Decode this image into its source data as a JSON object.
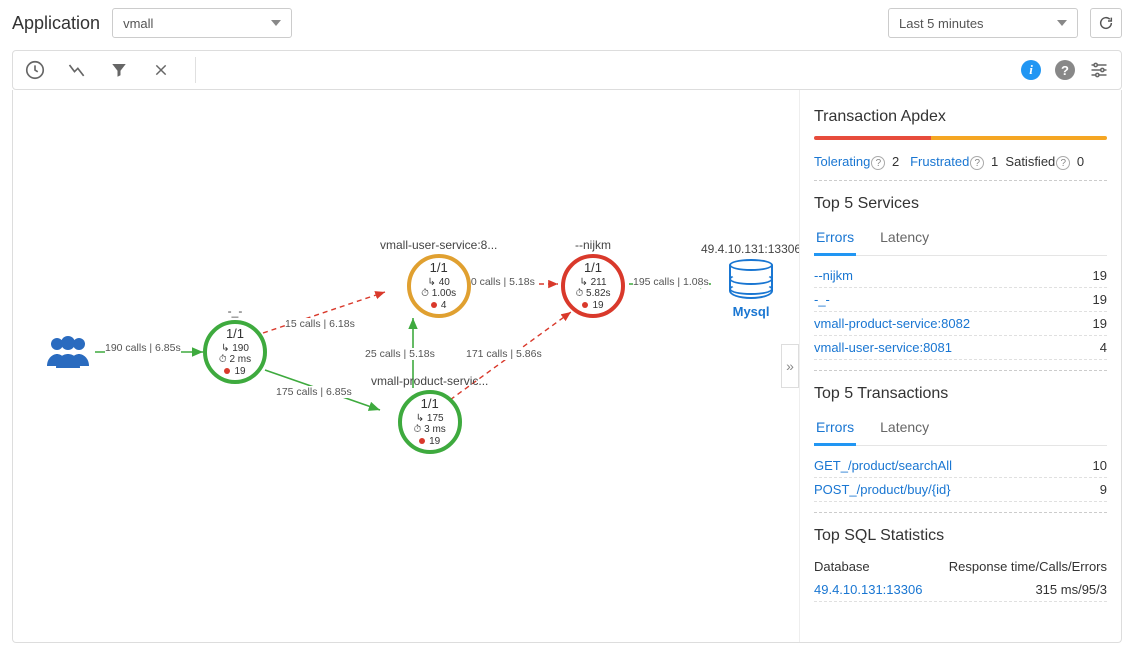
{
  "header": {
    "app_label": "Application",
    "app_value": "vmall",
    "time_value": "Last 5 minutes"
  },
  "apdex": {
    "title": "Transaction Apdex",
    "segments": [
      {
        "color": "#e74c3c",
        "pct": 40
      },
      {
        "color": "#f5a623",
        "pct": 60
      }
    ],
    "tolerating_label": "Tolerating",
    "tolerating_val": "2",
    "frustrated_label": "Frustrated",
    "frustrated_val": "1",
    "satisfied_label": "Satisfied",
    "satisfied_val": "0"
  },
  "top_services": {
    "title": "Top 5 Services",
    "tabs": {
      "errors": "Errors",
      "latency": "Latency"
    },
    "rows": [
      {
        "name": "--nijkm",
        "val": "19"
      },
      {
        "name": "-_-",
        "val": "19"
      },
      {
        "name": "vmall-product-service:8082",
        "val": "19"
      },
      {
        "name": "vmall-user-service:8081",
        "val": "4"
      }
    ]
  },
  "top_tx": {
    "title": "Top 5 Transactions",
    "tabs": {
      "errors": "Errors",
      "latency": "Latency"
    },
    "rows": [
      {
        "name": "GET_/product/searchAll",
        "val": "10"
      },
      {
        "name": "POST_/product/buy/{id}",
        "val": "9"
      }
    ]
  },
  "top_sql": {
    "title": "Top SQL Statistics",
    "col1": "Database",
    "col2": "Response time/Calls/Errors",
    "rows": [
      {
        "name": "49.4.10.131:13306",
        "val": "315 ms/95/3"
      }
    ]
  },
  "topo": {
    "users_edge": "190 calls | 6.85s",
    "nodes": {
      "gateway": {
        "label": "-_-",
        "frac": "1/1",
        "l1": "↳ 190",
        "l2": "⏱ 2 ms",
        "l3": "19"
      },
      "user": {
        "label": "vmall-user-service:8...",
        "frac": "1/1",
        "l1": "↳ 40",
        "l2": "⏱ 1.00s",
        "l3": "4"
      },
      "product": {
        "label": "vmall-product-servic...",
        "frac": "1/1",
        "l1": "↳ 175",
        "l2": "⏱ 3 ms",
        "l3": "19"
      },
      "nijkm": {
        "label": "--nijkm",
        "frac": "1/1",
        "l1": "↳ 211",
        "l2": "⏱ 5.82s",
        "l3": "19"
      },
      "db": {
        "label": "49.4.10.131:13306",
        "name": "Mysql"
      }
    },
    "edges": {
      "g_u": "15 calls | 6.18s",
      "g_p": "175 calls | 6.85s",
      "p_u": "25 calls | 5.18s",
      "u_n": "40 calls | 5.18s",
      "p_n": "171 calls | 5.86s",
      "n_d": "195 calls | 1.08s"
    }
  }
}
